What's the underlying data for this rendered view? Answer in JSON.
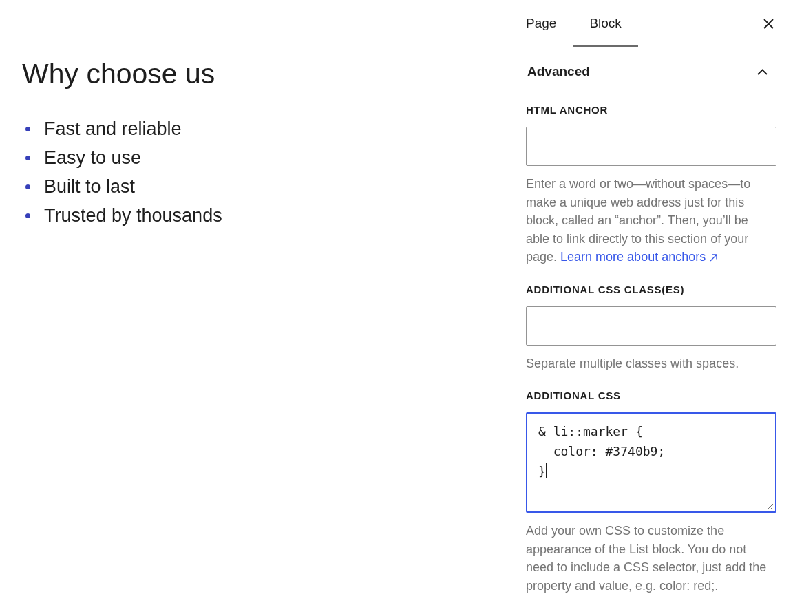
{
  "canvas": {
    "heading": "Why choose us",
    "list_items": [
      "Fast and reliable",
      "Easy to use",
      "Built to last",
      "Trusted by thousands"
    ]
  },
  "sidebar": {
    "tabs": [
      {
        "label": "Page",
        "selected": false
      },
      {
        "label": "Block",
        "selected": true
      }
    ],
    "panel": {
      "title": "Advanced",
      "expanded": true,
      "fields": [
        {
          "kind": "input",
          "label": "HTML ANCHOR",
          "focused": false,
          "help": "Enter a word or two—without spaces—to make a unique web address just for this block, called an “anchor”. Then, you’ll be able to link directly to this section of your page.",
          "link": "Learn more about anchors"
        },
        {
          "kind": "input",
          "label": "ADDITIONAL CSS CLASS(ES)",
          "focused": false,
          "help": "Separate multiple classes with spaces."
        },
        {
          "kind": "textarea",
          "label": "ADDITIONAL CSS",
          "focused": true,
          "value": "& li::marker {\n  color: #3740b9;\n}",
          "help": "Add your own CSS to customize the appearance of the List block. You do not need to include a CSS selector, just add the property and value, e.g. color: red;."
        }
      ]
    }
  }
}
